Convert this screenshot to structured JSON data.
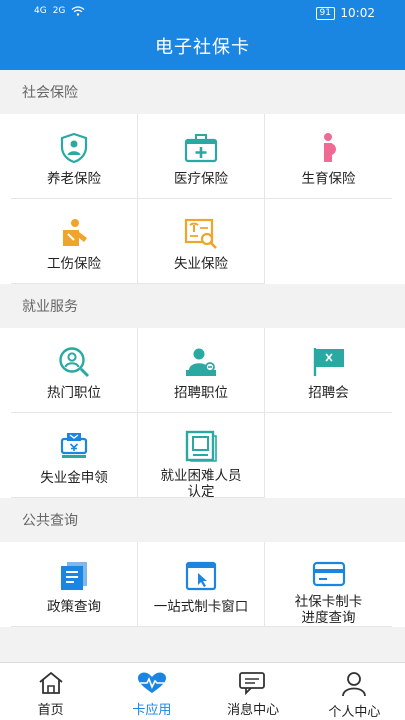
{
  "status": {
    "signal1": "4G",
    "signal2": "2G",
    "battery": "91",
    "time": "10:02"
  },
  "title": "电子社保卡",
  "colors": {
    "brand": "#1a86e2",
    "teal": "#2aa9a3",
    "orange": "#f0a42a",
    "pink": "#f06b93"
  },
  "sections": [
    {
      "header": "社会保险",
      "items": [
        {
          "label": "养老保险",
          "icon": "shield-person-icon"
        },
        {
          "label": "医疗保险",
          "icon": "medical-kit-icon"
        },
        {
          "label": "生育保险",
          "icon": "pregnant-icon"
        },
        {
          "label": "工伤保险",
          "icon": "injury-icon"
        },
        {
          "label": "失业保险",
          "icon": "unemployment-doc-icon"
        }
      ]
    },
    {
      "header": "就业服务",
      "items": [
        {
          "label": "热门职位",
          "icon": "person-search-icon"
        },
        {
          "label": "招聘职位",
          "icon": "recruiter-icon"
        },
        {
          "label": "招聘会",
          "icon": "flag-icon"
        },
        {
          "label": "失业金申领",
          "icon": "benefit-stamp-icon"
        },
        {
          "label": "就业困难人员认定",
          "label_line1": "就业困难人员",
          "label_line2": "认定",
          "icon": "document-stack-icon"
        }
      ]
    },
    {
      "header": "公共查询",
      "items": [
        {
          "label": "政策查询",
          "icon": "policy-doc-icon"
        },
        {
          "label": "一站式制卡窗口",
          "icon": "window-cursor-icon"
        },
        {
          "label": "社保卡制卡进度查询",
          "label_line1": "社保卡制卡",
          "label_line2": "进度查询",
          "icon": "card-icon"
        }
      ]
    }
  ],
  "tabs": [
    {
      "label": "首页",
      "icon": "home-icon",
      "active": false
    },
    {
      "label": "卡应用",
      "icon": "heart-pulse-icon",
      "active": true
    },
    {
      "label": "消息中心",
      "icon": "chat-icon",
      "active": false
    },
    {
      "label": "个人中心",
      "icon": "user-icon",
      "active": false
    }
  ]
}
